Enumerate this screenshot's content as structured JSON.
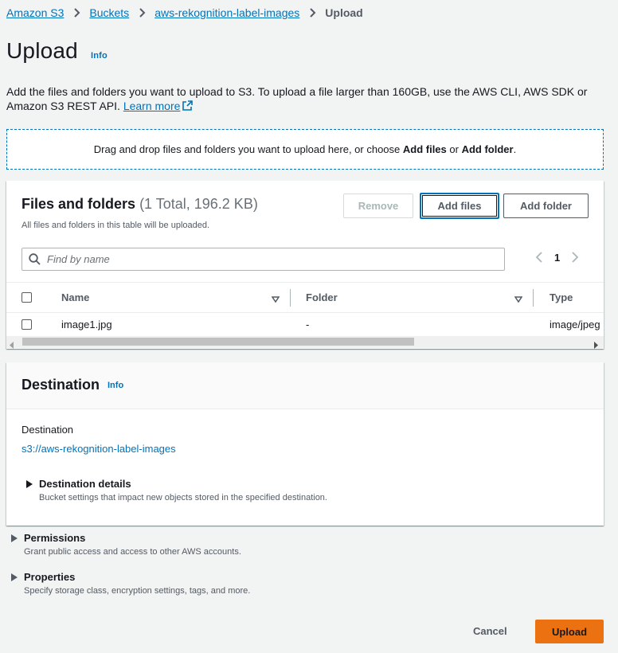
{
  "breadcrumb": {
    "items": [
      "Amazon S3",
      "Buckets",
      "aws-rekognition-label-images"
    ],
    "current": "Upload"
  },
  "page": {
    "title": "Upload",
    "info": "Info",
    "description": "Add the files and folders you want to upload to S3. To upload a file larger than 160GB, use the AWS CLI, AWS SDK or Amazon S3 REST API.",
    "learn_more": "Learn more"
  },
  "dropzone": {
    "text_before": "Drag and drop files and folders you want to upload here, or choose ",
    "add_files": "Add files",
    "or": " or ",
    "add_folder": "Add folder",
    "period": "."
  },
  "files": {
    "title": "Files and folders",
    "count": "(1 Total, 196.2 KB)",
    "subtitle": "All files and folders in this table will be uploaded.",
    "remove_label": "Remove",
    "add_files_label": "Add files",
    "add_folder_label": "Add folder",
    "search_placeholder": "Find by name",
    "page_number": "1",
    "columns": [
      "Name",
      "Folder",
      "Type"
    ],
    "rows": [
      {
        "name": "image1.jpg",
        "folder": "-",
        "type": "image/jpeg"
      }
    ]
  },
  "destination": {
    "title": "Destination",
    "info": "Info",
    "label": "Destination",
    "uri": "s3://aws-rekognition-label-images",
    "details_title": "Destination details",
    "details_sub": "Bucket settings that impact new objects stored in the specified destination."
  },
  "permissions": {
    "title": "Permissions",
    "sub": "Grant public access and access to other AWS accounts."
  },
  "properties": {
    "title": "Properties",
    "sub": "Specify storage class, encryption settings, tags, and more."
  },
  "footer": {
    "cancel_label": "Cancel",
    "upload_label": "Upload"
  },
  "colors": {
    "link": "#0073bb",
    "primary_button": "#ec7211",
    "background": "#f2f3f3"
  }
}
